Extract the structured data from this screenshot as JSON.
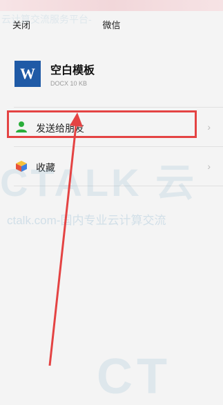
{
  "header": {
    "close_label": "关闭",
    "title": "微信"
  },
  "file": {
    "icon_letter": "W",
    "name": "空白模板",
    "meta": "DOCX 10 KB"
  },
  "actions": [
    {
      "label": "发送给朋友",
      "icon": "person-icon"
    },
    {
      "label": "收藏",
      "icon": "cube-icon"
    }
  ],
  "chevron": "›",
  "watermark": {
    "line1": "云计算交流服务平台-",
    "line2": "ctalk.com-国内专业云计算交流",
    "logo": "CTALK 云",
    "logo2": "CT"
  },
  "colors": {
    "highlight": "#e44343",
    "word_blue": "#1f5aa6"
  }
}
